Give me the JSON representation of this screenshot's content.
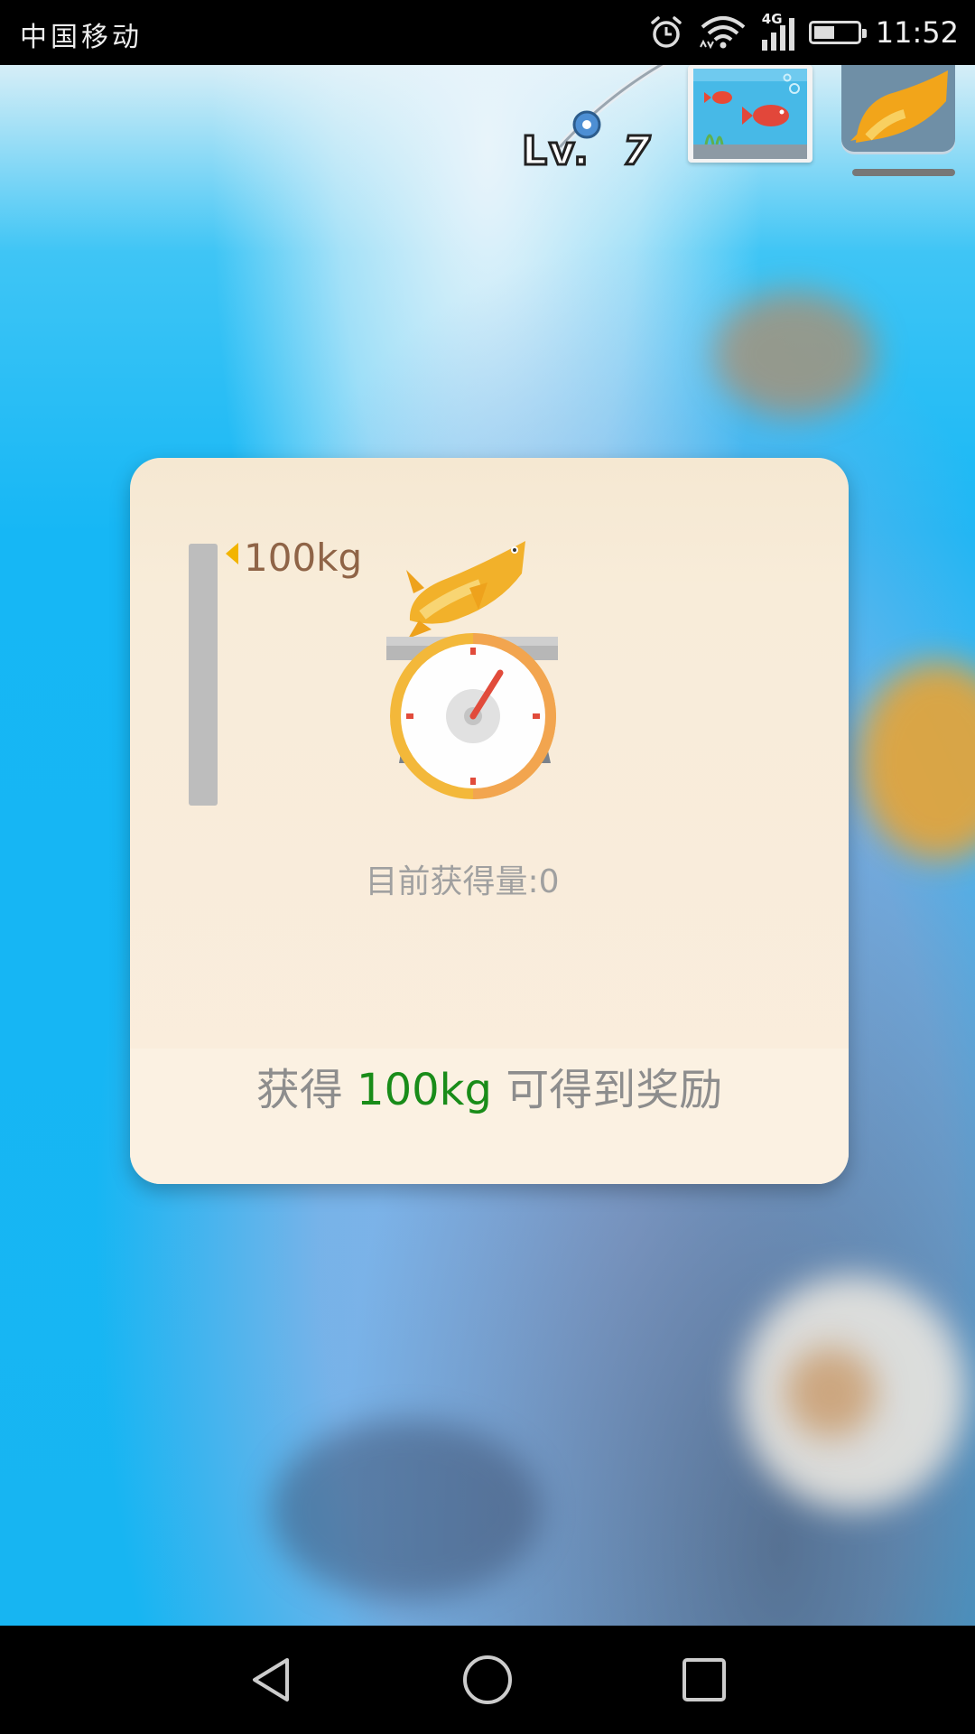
{
  "status_bar": {
    "carrier": "中国移动",
    "network": "4G",
    "time": "11:52",
    "battery_level": 0.45,
    "icons": [
      "alarm-icon",
      "wifi-icon",
      "signal-icon",
      "battery-icon"
    ]
  },
  "hud": {
    "level_prefix": "Lv.",
    "level_value": "7",
    "buttons": [
      "fishing-rod-icon",
      "aquarium-button",
      "fish-collection-button"
    ]
  },
  "dialog": {
    "gauge_target_label": "100kg",
    "gauge_progress": 0,
    "current_amount_label": "目前获得量:0",
    "reward_prefix": "获得",
    "reward_amount": "100kg",
    "reward_suffix": "可得到奖励"
  },
  "colors": {
    "dialog_bg": "#f8ecd9",
    "gauge_marker": "#f2b400",
    "reward_highlight": "#198c19",
    "water": "#17b5f2"
  },
  "nav_bar": {
    "icons": [
      "back-icon",
      "home-icon",
      "recents-icon"
    ]
  }
}
